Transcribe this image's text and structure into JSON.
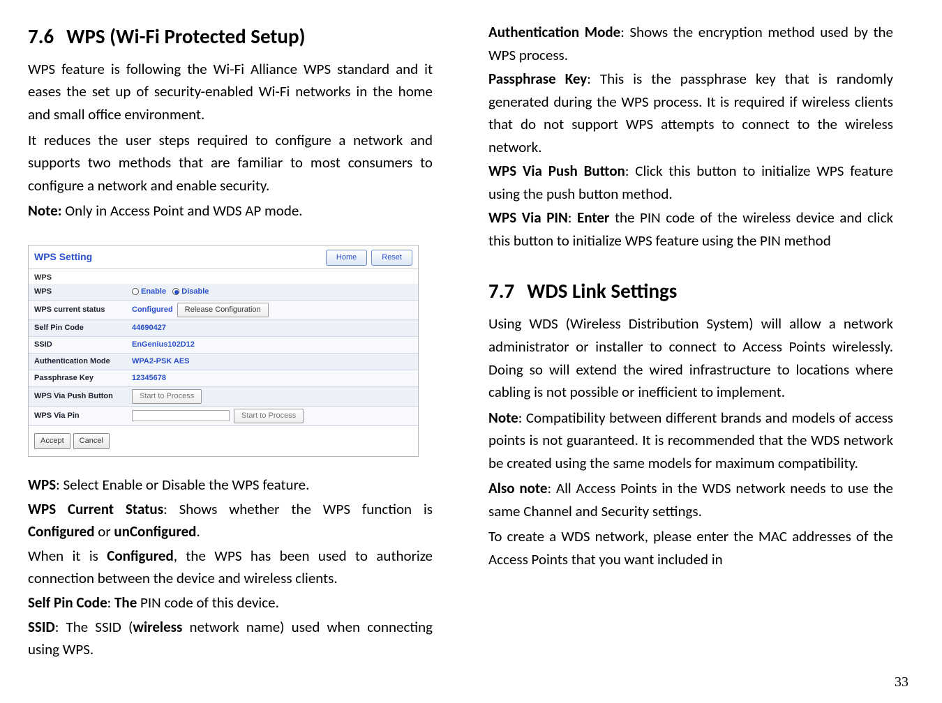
{
  "page_number": "33",
  "left": {
    "heading_num": "7.6",
    "heading_text": "WPS (Wi-Fi Protected Setup)",
    "p1": "WPS feature is following the Wi-Fi Alliance WPS standard and it eases the set up of security-enabled Wi-Fi networks in the home and small office environment.",
    "p2": "It reduces the user steps required to configure a network and supports two methods that are familiar to most consumers to configure a network and enable security.",
    "note_label": "Note:",
    "note_text": " Only in Access Point and WDS AP mode.",
    "shot": {
      "title": "WPS Setting",
      "home": "Home",
      "reset": "Reset",
      "section": "WPS",
      "rows": {
        "wps_lbl": "WPS",
        "wps_enable": "Enable",
        "wps_disable": "Disable",
        "status_lbl": "WPS current status",
        "status_val": "Configured",
        "release_btn": "Release Configuration",
        "selfpin_lbl": "Self Pin Code",
        "selfpin_val": "44690427",
        "ssid_lbl": "SSID",
        "ssid_val": "EnGenius102D12",
        "auth_lbl": "Authentication Mode",
        "auth_val": "WPA2-PSK AES",
        "pass_lbl": "Passphrase Key",
        "pass_val": "12345678",
        "push_lbl": "WPS Via Push Button",
        "push_btn": "Start to Process",
        "pin_lbl": "WPS Via Pin",
        "pin_btn": "Start to Process"
      },
      "accept": "Accept",
      "cancel": "Cancel"
    },
    "defs": {
      "wps_t": "WPS",
      "wps_b": ": Select Enable or Disable the WPS feature.",
      "cur_t": "WPS Current Status",
      "cur_b1": ": Shows whether the WPS function is ",
      "cur_cfg": "Configured",
      "cur_or": " or ",
      "cur_un": "unConfigured",
      "cur_dot": ".",
      "cfg_p1a": "When it is ",
      "cfg_p1b": "Configured",
      "cfg_p1c": ", the WPS has been used to authorize connection between the device and wireless clients.",
      "spc_t": "Self Pin Code",
      "spc_b1": ": ",
      "spc_b1b": "The",
      "spc_b2": " PIN code of this device.",
      "ssid_t": "SSID",
      "ssid_b1": ": The SSID (",
      "ssid_w": "wireless",
      "ssid_b2": " network name) used when connecting using WPS."
    }
  },
  "right": {
    "auth_t": "Authentication Mode",
    "auth_b": ": Shows the encryption method used by the WPS process.",
    "pk_t": "Passphrase Key",
    "pk_b": ": This is the passphrase key that is randomly generated during the WPS process. It is required if wireless clients that do not support WPS attempts to connect to the wireless network.",
    "pb_t": "WPS Via Push Button",
    "pb_b": ": Click this button to initialize WPS feature using the push button method.",
    "pin_t": "WPS Via PIN",
    "pin_b1": ": ",
    "pin_enter": "Enter",
    "pin_b2": " the PIN code of the wireless device and click this button to initialize WPS feature using the PIN method",
    "heading_num": "7.7",
    "heading_text": "WDS Link Settings",
    "p1": "Using WDS (Wireless Distribution System) will allow a network administrator or installer to connect to Access Points wirelessly. Doing so will extend the wired infrastructure to locations where cabling is not possible or inefficient to implement.",
    "note_t": "Note",
    "note_b": ": Compatibility between different brands and models of access points is not guaranteed. It is recommended that the WDS network be created using the same models for maximum compatibility.",
    "also_t": "Also note",
    "also_b": ": All Access Points in the WDS network needs to use the same Channel and Security settings.",
    "p2": "To create a WDS network, please enter the MAC addresses of the Access Points that you want included in"
  }
}
